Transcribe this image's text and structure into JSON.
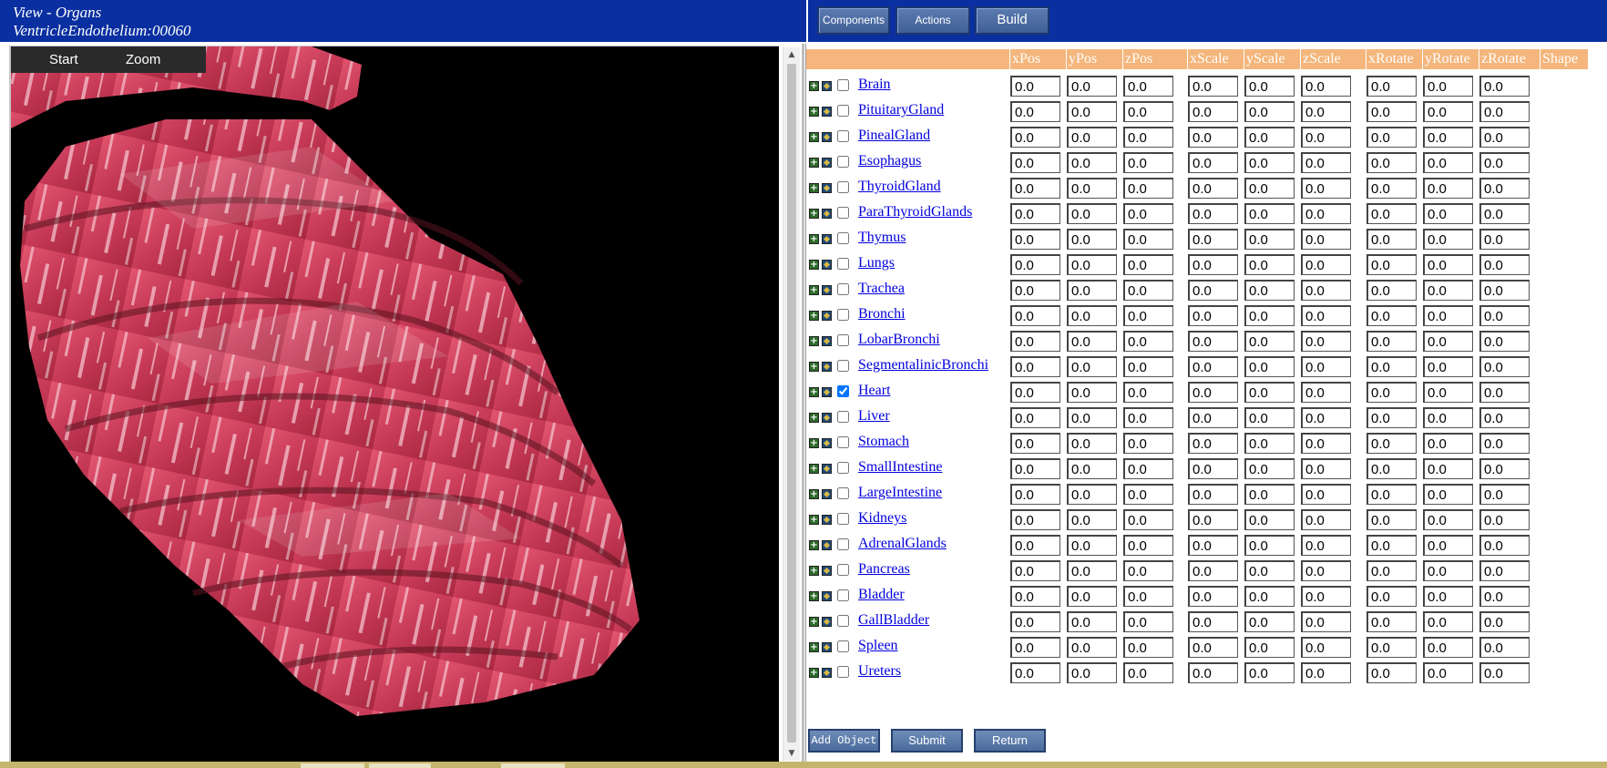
{
  "header": {
    "view_title": "View - Organs",
    "object_name": "VentricleEndothelium:00060"
  },
  "menu": {
    "components": "Components",
    "actions": "Actions",
    "build": "Build"
  },
  "viewer": {
    "start": "Start",
    "zoom": "Zoom"
  },
  "columns": [
    "xPos",
    "yPos",
    "zPos",
    "xScale",
    "yScale",
    "zScale",
    "xRotate",
    "yRotate",
    "zRotate",
    "Shape"
  ],
  "organs": [
    {
      "name": "Brain",
      "checked": false,
      "values": [
        "0.0",
        "0.0",
        "0.0",
        "0.0",
        "0.0",
        "0.0",
        "0.0",
        "0.0",
        "0.0"
      ]
    },
    {
      "name": "PituitaryGland",
      "checked": false,
      "values": [
        "0.0",
        "0.0",
        "0.0",
        "0.0",
        "0.0",
        "0.0",
        "0.0",
        "0.0",
        "0.0"
      ]
    },
    {
      "name": "PinealGland",
      "checked": false,
      "values": [
        "0.0",
        "0.0",
        "0.0",
        "0.0",
        "0.0",
        "0.0",
        "0.0",
        "0.0",
        "0.0"
      ]
    },
    {
      "name": "Esophagus",
      "checked": false,
      "values": [
        "0.0",
        "0.0",
        "0.0",
        "0.0",
        "0.0",
        "0.0",
        "0.0",
        "0.0",
        "0.0"
      ]
    },
    {
      "name": "ThyroidGland",
      "checked": false,
      "values": [
        "0.0",
        "0.0",
        "0.0",
        "0.0",
        "0.0",
        "0.0",
        "0.0",
        "0.0",
        "0.0"
      ]
    },
    {
      "name": "ParaThyroidGlands",
      "checked": false,
      "values": [
        "0.0",
        "0.0",
        "0.0",
        "0.0",
        "0.0",
        "0.0",
        "0.0",
        "0.0",
        "0.0"
      ]
    },
    {
      "name": "Thymus",
      "checked": false,
      "values": [
        "0.0",
        "0.0",
        "0.0",
        "0.0",
        "0.0",
        "0.0",
        "0.0",
        "0.0",
        "0.0"
      ]
    },
    {
      "name": "Lungs",
      "checked": false,
      "values": [
        "0.0",
        "0.0",
        "0.0",
        "0.0",
        "0.0",
        "0.0",
        "0.0",
        "0.0",
        "0.0"
      ]
    },
    {
      "name": "Trachea",
      "checked": false,
      "values": [
        "0.0",
        "0.0",
        "0.0",
        "0.0",
        "0.0",
        "0.0",
        "0.0",
        "0.0",
        "0.0"
      ]
    },
    {
      "name": "Bronchi",
      "checked": false,
      "values": [
        "0.0",
        "0.0",
        "0.0",
        "0.0",
        "0.0",
        "0.0",
        "0.0",
        "0.0",
        "0.0"
      ]
    },
    {
      "name": "LobarBronchi",
      "checked": false,
      "values": [
        "0.0",
        "0.0",
        "0.0",
        "0.0",
        "0.0",
        "0.0",
        "0.0",
        "0.0",
        "0.0"
      ]
    },
    {
      "name": "SegmentalinicBronchi",
      "checked": false,
      "values": [
        "0.0",
        "0.0",
        "0.0",
        "0.0",
        "0.0",
        "0.0",
        "0.0",
        "0.0",
        "0.0"
      ]
    },
    {
      "name": "Heart",
      "checked": true,
      "values": [
        "0.0",
        "0.0",
        "0.0",
        "0.0",
        "0.0",
        "0.0",
        "0.0",
        "0.0",
        "0.0"
      ]
    },
    {
      "name": "Liver",
      "checked": false,
      "values": [
        "0.0",
        "0.0",
        "0.0",
        "0.0",
        "0.0",
        "0.0",
        "0.0",
        "0.0",
        "0.0"
      ]
    },
    {
      "name": "Stomach",
      "checked": false,
      "values": [
        "0.0",
        "0.0",
        "0.0",
        "0.0",
        "0.0",
        "0.0",
        "0.0",
        "0.0",
        "0.0"
      ]
    },
    {
      "name": "SmallIntestine",
      "checked": false,
      "values": [
        "0.0",
        "0.0",
        "0.0",
        "0.0",
        "0.0",
        "0.0",
        "0.0",
        "0.0",
        "0.0"
      ]
    },
    {
      "name": "LargeIntestine",
      "checked": false,
      "values": [
        "0.0",
        "0.0",
        "0.0",
        "0.0",
        "0.0",
        "0.0",
        "0.0",
        "0.0",
        "0.0"
      ]
    },
    {
      "name": "Kidneys",
      "checked": false,
      "values": [
        "0.0",
        "0.0",
        "0.0",
        "0.0",
        "0.0",
        "0.0",
        "0.0",
        "0.0",
        "0.0"
      ]
    },
    {
      "name": "AdrenalGlands",
      "checked": false,
      "values": [
        "0.0",
        "0.0",
        "0.0",
        "0.0",
        "0.0",
        "0.0",
        "0.0",
        "0.0",
        "0.0"
      ]
    },
    {
      "name": "Pancreas",
      "checked": false,
      "values": [
        "0.0",
        "0.0",
        "0.0",
        "0.0",
        "0.0",
        "0.0",
        "0.0",
        "0.0",
        "0.0"
      ]
    },
    {
      "name": "Bladder",
      "checked": false,
      "values": [
        "0.0",
        "0.0",
        "0.0",
        "0.0",
        "0.0",
        "0.0",
        "0.0",
        "0.0",
        "0.0"
      ]
    },
    {
      "name": "GallBladder",
      "checked": false,
      "values": [
        "0.0",
        "0.0",
        "0.0",
        "0.0",
        "0.0",
        "0.0",
        "0.0",
        "0.0",
        "0.0"
      ]
    },
    {
      "name": "Spleen",
      "checked": false,
      "values": [
        "0.0",
        "0.0",
        "0.0",
        "0.0",
        "0.0",
        "0.0",
        "0.0",
        "0.0",
        "0.0"
      ]
    },
    {
      "name": "Ureters",
      "checked": false,
      "values": [
        "0.0",
        "0.0",
        "0.0",
        "0.0",
        "0.0",
        "0.0",
        "0.0",
        "0.0",
        "0.0"
      ]
    }
  ],
  "actions": {
    "add_object": "Add Object",
    "submit": "Submit",
    "return": "Return"
  },
  "colors": {
    "header_blue": "#0a2fa0",
    "table_header": "#f4b67c",
    "link": "#0000dd",
    "organ_texture": "#c8385a"
  }
}
